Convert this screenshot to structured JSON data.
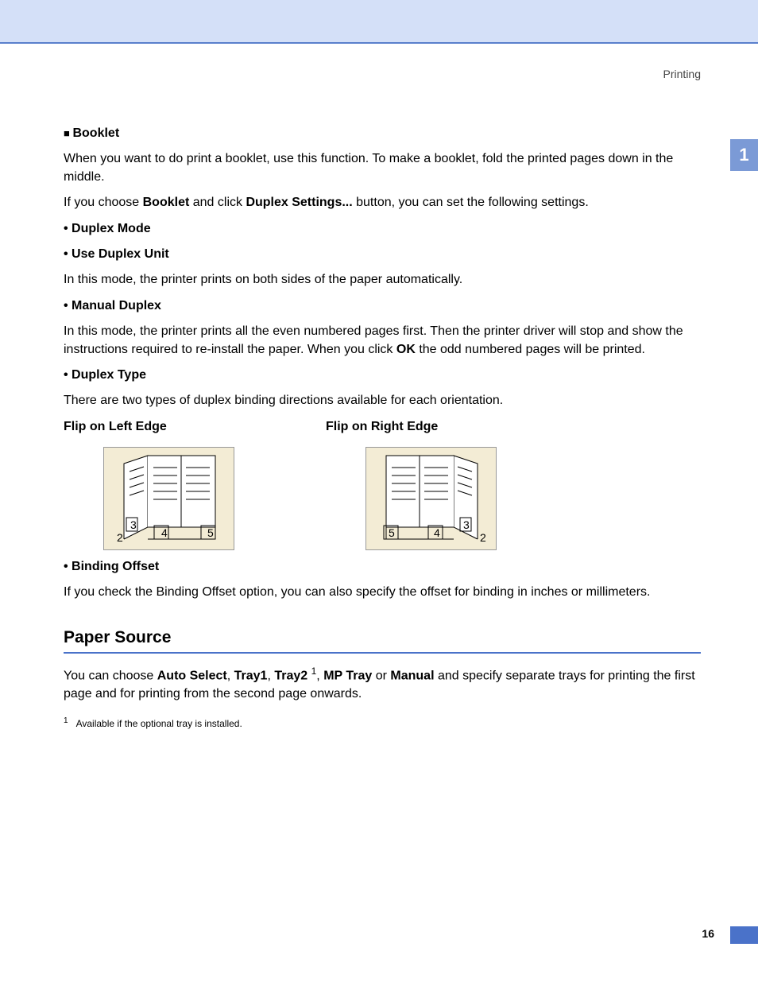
{
  "header": {
    "section": "Printing"
  },
  "sidetab": "1",
  "booklet": {
    "title": "Booklet",
    "intro": "When you want to do print a booklet, use this function. To make a booklet, fold the printed pages down in the middle.",
    "choose_prefix": "If you choose ",
    "choose_bold1": "Booklet",
    "choose_mid": " and click ",
    "choose_bold2": "Duplex Settings...",
    "choose_suffix": " button, you can set the following settings.",
    "duplex_mode": {
      "label": "Duplex Mode",
      "use_duplex_unit": {
        "label": "Use Duplex Unit",
        "text": "In this mode, the printer prints on both sides of the paper automatically."
      },
      "manual_duplex": {
        "label": "Manual Duplex",
        "text_prefix": "In this mode, the printer prints all the even numbered pages first. Then the printer driver will stop and show the instructions required to re-install the paper. When you click ",
        "text_bold": "OK",
        "text_suffix": " the odd numbered pages will be printed."
      }
    },
    "duplex_type": {
      "label": "Duplex Type",
      "text": "There are two types of duplex binding directions available for each orientation."
    },
    "diagrams": {
      "left": {
        "label": "Flip on Left Edge"
      },
      "right": {
        "label": "Flip on Right Edge"
      }
    },
    "binding_offset": {
      "label": "Binding Offset",
      "text": "If you check the Binding Offset option, you can also specify the offset for binding in inches or millimeters."
    }
  },
  "paper_source": {
    "heading": "Paper Source",
    "text_prefix": "You can choose ",
    "opt1": "Auto Select",
    "opt2": "Tray1",
    "opt3": "Tray2",
    "sup": "1",
    "opt4": "MP Tray",
    "opt5": "Manual",
    "text_suffix": " and specify separate trays for printing the first page and for printing from the second page onwards.",
    "footnote": "Available if the optional tray is installed."
  },
  "page_number": "16"
}
